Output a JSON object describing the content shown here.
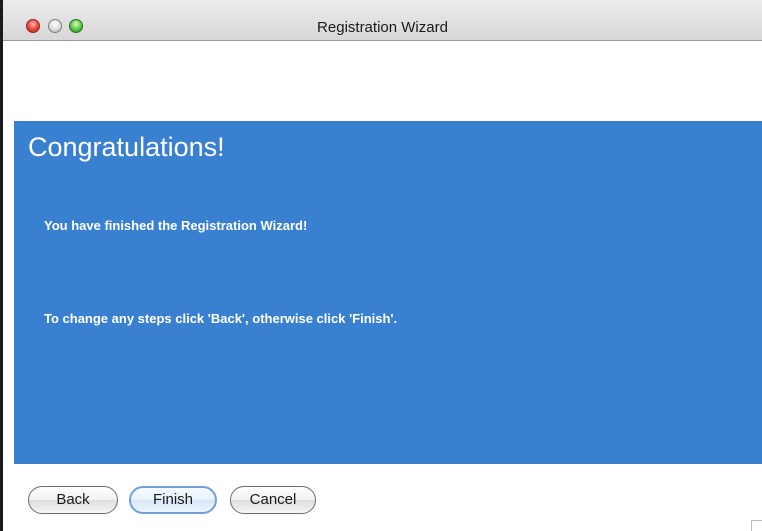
{
  "window": {
    "title": "Registration Wizard",
    "controls": {
      "close_icon": "close-button-icon",
      "minimize_icon": "minimize-button-icon",
      "zoom_icon": "zoom-button-icon"
    }
  },
  "panel": {
    "heading": "Congratulations!",
    "message_1": "You have finished the Registration Wizard!",
    "message_2": "To change any steps click 'Back', otherwise click 'Finish'.",
    "background_color": "#3a80d0"
  },
  "buttons": {
    "back_label": "Back",
    "finish_label": "Finish",
    "cancel_label": "Cancel"
  }
}
